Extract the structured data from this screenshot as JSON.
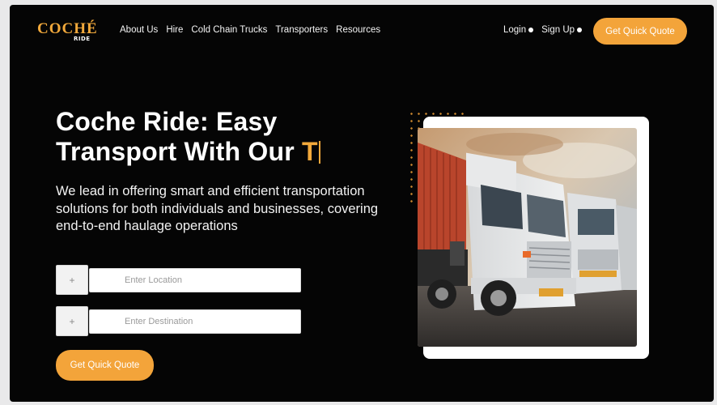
{
  "brand": {
    "logo_text": "COCHÉ",
    "logo_sub": "RIDE"
  },
  "nav": {
    "items": [
      "About Us",
      "Hire",
      "Cold Chain Trucks",
      "Transporters",
      "Resources"
    ]
  },
  "auth": {
    "login": "Login",
    "signup": "Sign Up"
  },
  "header": {
    "quote_button": "Get Quick Quote"
  },
  "hero": {
    "title_line1": "Coche Ride: Easy",
    "title_line2": "Transport With Our ",
    "typed_text": "T",
    "description": "We lead in offering smart and efficient transportation solutions for both individuals and businesses, covering end-to-end haulage operations",
    "plus_symbol": "+",
    "location_placeholder": "Enter Location",
    "destination_placeholder": "Enter Destination",
    "quote_button": "Get Quick Quote"
  },
  "colors": {
    "accent": "#f3a43a",
    "background": "#050505",
    "text": "#ffffff"
  },
  "icons": {
    "auth_dropdown": "dot-icon"
  }
}
